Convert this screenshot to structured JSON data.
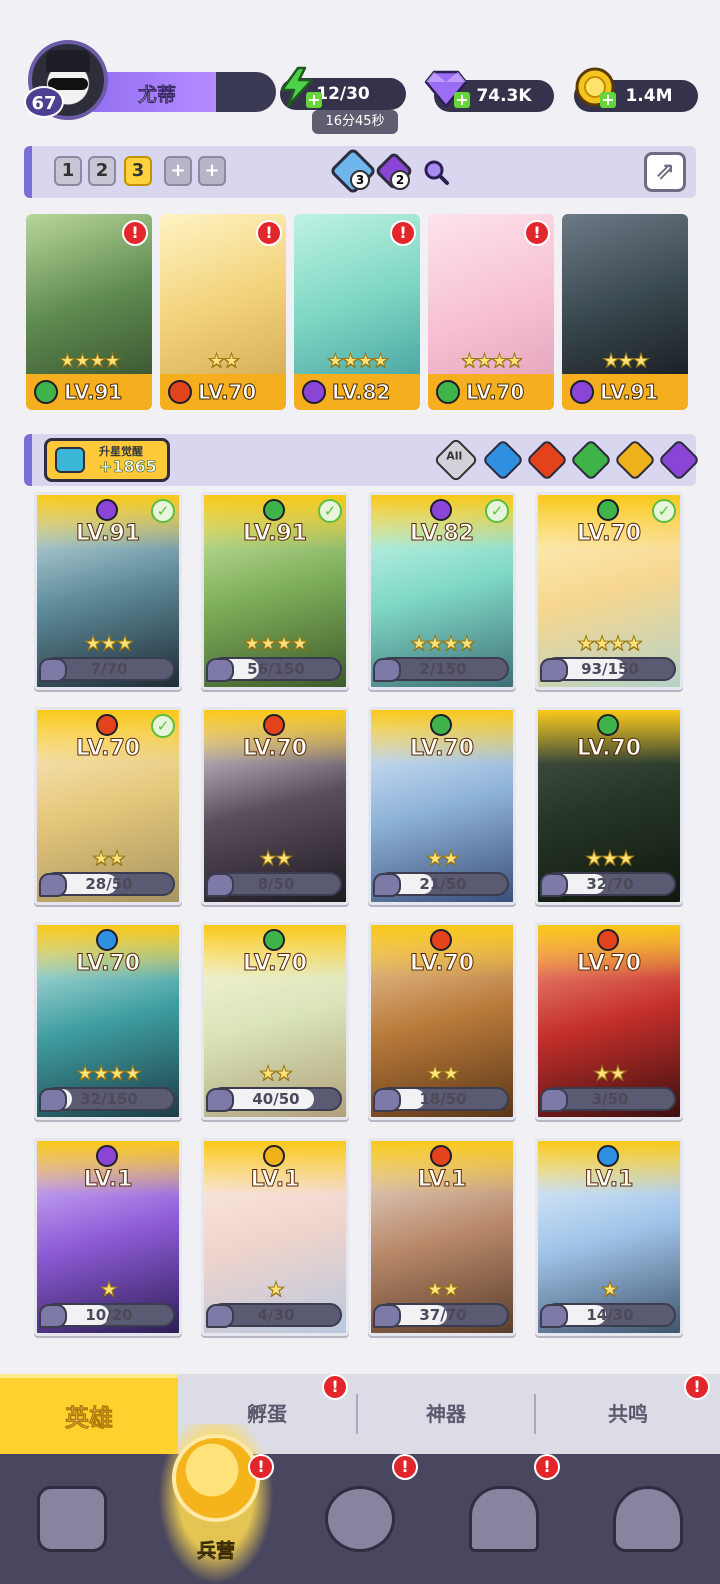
{
  "profile": {
    "name": "尤蒂",
    "level": "67"
  },
  "resources": {
    "energy": "12/30",
    "energy_timer": "16分45秒",
    "gems": "74.3K",
    "coins": "1.4M"
  },
  "team_slots": [
    "1",
    "2",
    "3",
    "+",
    "+"
  ],
  "active_slot": "3",
  "crystals": {
    "blue_count": "3",
    "purple_count": "2"
  },
  "team_heroes": [
    {
      "level": "LV.91",
      "stars": "★★★★",
      "element": "wind",
      "alert": "!"
    },
    {
      "level": "LV.70",
      "stars": "★★",
      "element": "fire",
      "alert": "!"
    },
    {
      "level": "LV.82",
      "stars": "★★★★",
      "element": "dark",
      "alert": "!"
    },
    {
      "level": "LV.70",
      "stars": "★★★★",
      "element": "wind",
      "alert": "!"
    },
    {
      "level": "LV.91",
      "stars": "★★★",
      "element": "dark",
      "alert": ""
    }
  ],
  "awaken": {
    "label": "升星觉醒",
    "value": "+1865"
  },
  "filters": [
    "All",
    "water",
    "fire",
    "wind",
    "light",
    "dark"
  ],
  "filter_all_label": "All",
  "heroes": [
    {
      "level": "LV.91",
      "element": "dark",
      "stars": "★★★",
      "shards": "7/70",
      "progress": 0.1,
      "check": true
    },
    {
      "level": "LV.91",
      "element": "wind",
      "stars": "★★★★",
      "shards": "56/150",
      "progress": 0.37,
      "check": true
    },
    {
      "level": "LV.82",
      "element": "dark",
      "stars": "★★★★",
      "shards": "2/150",
      "progress": 0.01,
      "check": true
    },
    {
      "level": "LV.70",
      "element": "wind",
      "stars": "★★★★",
      "shards": "93/150",
      "progress": 0.62,
      "check": true
    },
    {
      "level": "LV.70",
      "element": "fire",
      "stars": "★★",
      "shards": "28/50",
      "progress": 0.56,
      "check": true
    },
    {
      "level": "LV.70",
      "element": "fire",
      "stars": "★★",
      "shards": "8/50",
      "progress": 0.16,
      "check": false
    },
    {
      "level": "LV.70",
      "element": "wind",
      "stars": "★★",
      "shards": "21/50",
      "progress": 0.42,
      "check": false
    },
    {
      "level": "LV.70",
      "element": "wind",
      "stars": "★★★",
      "shards": "32/70",
      "progress": 0.46,
      "check": false
    },
    {
      "level": "LV.70",
      "element": "water",
      "stars": "★★★★",
      "shards": "32/150",
      "progress": 0.21,
      "check": false
    },
    {
      "level": "LV.70",
      "element": "wind",
      "stars": "★★",
      "shards": "40/50",
      "progress": 0.8,
      "check": false
    },
    {
      "level": "LV.70",
      "element": "fire",
      "stars": "★★",
      "shards": "18/50",
      "progress": 0.36,
      "check": false
    },
    {
      "level": "LV.70",
      "element": "fire",
      "stars": "★★",
      "shards": "3/50",
      "progress": 0.06,
      "check": false
    },
    {
      "level": "LV.1",
      "element": "dark",
      "stars": "★",
      "shards": "10/20",
      "progress": 0.5,
      "check": false
    },
    {
      "level": "LV.1",
      "element": "light",
      "stars": "★",
      "shards": "4/30",
      "progress": 0.13,
      "check": false
    },
    {
      "level": "LV.1",
      "element": "fire",
      "stars": "★★",
      "shards": "37/70",
      "progress": 0.53,
      "check": false
    },
    {
      "level": "LV.1",
      "element": "water",
      "stars": "★",
      "shards": "14/30",
      "progress": 0.47,
      "check": false
    }
  ],
  "sub_tabs": [
    {
      "label": "英雄",
      "alert": ""
    },
    {
      "label": "孵蛋",
      "alert": "!"
    },
    {
      "label": "神器",
      "alert": ""
    },
    {
      "label": "共鸣",
      "alert": "!"
    }
  ],
  "nav": [
    {
      "label": "",
      "icon": "cards-icon",
      "alert": ""
    },
    {
      "label": "兵营",
      "icon": "barracks-icon",
      "alert": "!"
    },
    {
      "label": "",
      "icon": "map-book-icon",
      "alert": "!"
    },
    {
      "label": "",
      "icon": "temple-icon",
      "alert": "!"
    },
    {
      "label": "",
      "icon": "mushroom-icon",
      "alert": ""
    }
  ],
  "colors": {
    "wind": "#3fb34a",
    "fire": "#e2431b",
    "dark": "#8a45d6",
    "water": "#2f8fe0",
    "light": "#f0b21a",
    "accent": "#ffd12e",
    "panel": "#d9d7ef"
  }
}
